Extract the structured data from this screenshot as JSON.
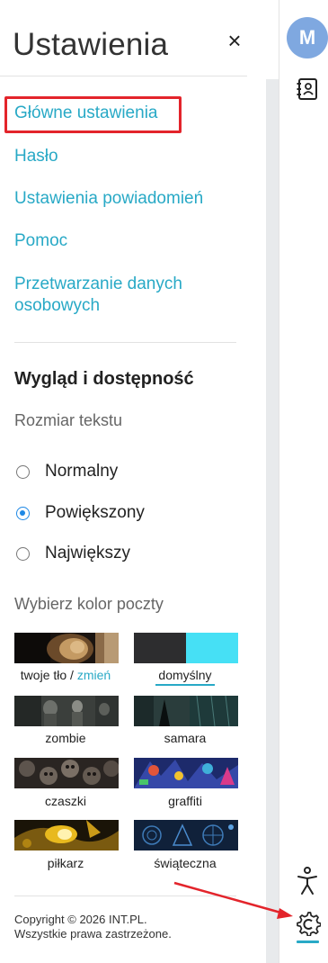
{
  "settings": {
    "title": "Ustawienia",
    "close_glyph": "×",
    "links": [
      {
        "label": "Główne ustawienia"
      },
      {
        "label": "Hasło"
      },
      {
        "label": "Ustawienia powiadomień"
      },
      {
        "label": "Pomoc"
      },
      {
        "label": "Przetwarzanie danych osobowych"
      }
    ]
  },
  "appearance": {
    "title": "Wygląd i dostępność",
    "text_size_label": "Rozmiar tekstu",
    "text_size_options": [
      {
        "label": "Normalny",
        "checked": false
      },
      {
        "label": "Powiększony",
        "checked": true
      },
      {
        "label": "Największy",
        "checked": false
      }
    ],
    "color_label": "Wybierz kolor poczty",
    "themes": [
      {
        "name": "twoje tło",
        "separator": " / ",
        "action": "zmień"
      },
      {
        "name": "domyślny",
        "selected": true
      },
      {
        "name": "zombie"
      },
      {
        "name": "samara"
      },
      {
        "name": "czaszki"
      },
      {
        "name": "graffiti"
      },
      {
        "name": "piłkarz"
      },
      {
        "name": "świąteczna"
      }
    ]
  },
  "footer": {
    "line1": "Copyright © 2026 INT.PL.",
    "line2": "Wszystkie prawa zastrzeżone."
  },
  "rail": {
    "avatar_letter": "M",
    "icons": [
      "contacts-icon",
      "accessibility-icon",
      "settings-gear-icon"
    ]
  },
  "colors": {
    "accent": "#28a9c6",
    "highlight": "#e3242b",
    "radio_checked": "#1e88e5",
    "avatar_bg": "#7fa8e0"
  }
}
